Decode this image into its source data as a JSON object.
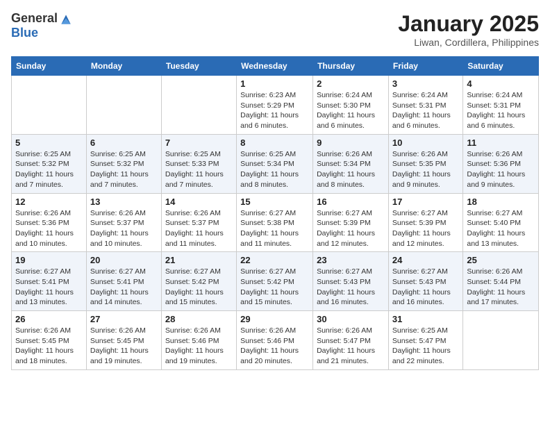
{
  "logo": {
    "general": "General",
    "blue": "Blue"
  },
  "header": {
    "month": "January 2025",
    "location": "Liwan, Cordillera, Philippines"
  },
  "days_of_week": [
    "Sunday",
    "Monday",
    "Tuesday",
    "Wednesday",
    "Thursday",
    "Friday",
    "Saturday"
  ],
  "weeks": [
    [
      {
        "day": "",
        "info": ""
      },
      {
        "day": "",
        "info": ""
      },
      {
        "day": "",
        "info": ""
      },
      {
        "day": "1",
        "info": "Sunrise: 6:23 AM\nSunset: 5:29 PM\nDaylight: 11 hours and 6 minutes."
      },
      {
        "day": "2",
        "info": "Sunrise: 6:24 AM\nSunset: 5:30 PM\nDaylight: 11 hours and 6 minutes."
      },
      {
        "day": "3",
        "info": "Sunrise: 6:24 AM\nSunset: 5:31 PM\nDaylight: 11 hours and 6 minutes."
      },
      {
        "day": "4",
        "info": "Sunrise: 6:24 AM\nSunset: 5:31 PM\nDaylight: 11 hours and 6 minutes."
      }
    ],
    [
      {
        "day": "5",
        "info": "Sunrise: 6:25 AM\nSunset: 5:32 PM\nDaylight: 11 hours and 7 minutes."
      },
      {
        "day": "6",
        "info": "Sunrise: 6:25 AM\nSunset: 5:32 PM\nDaylight: 11 hours and 7 minutes."
      },
      {
        "day": "7",
        "info": "Sunrise: 6:25 AM\nSunset: 5:33 PM\nDaylight: 11 hours and 7 minutes."
      },
      {
        "day": "8",
        "info": "Sunrise: 6:25 AM\nSunset: 5:34 PM\nDaylight: 11 hours and 8 minutes."
      },
      {
        "day": "9",
        "info": "Sunrise: 6:26 AM\nSunset: 5:34 PM\nDaylight: 11 hours and 8 minutes."
      },
      {
        "day": "10",
        "info": "Sunrise: 6:26 AM\nSunset: 5:35 PM\nDaylight: 11 hours and 9 minutes."
      },
      {
        "day": "11",
        "info": "Sunrise: 6:26 AM\nSunset: 5:36 PM\nDaylight: 11 hours and 9 minutes."
      }
    ],
    [
      {
        "day": "12",
        "info": "Sunrise: 6:26 AM\nSunset: 5:36 PM\nDaylight: 11 hours and 10 minutes."
      },
      {
        "day": "13",
        "info": "Sunrise: 6:26 AM\nSunset: 5:37 PM\nDaylight: 11 hours and 10 minutes."
      },
      {
        "day": "14",
        "info": "Sunrise: 6:26 AM\nSunset: 5:37 PM\nDaylight: 11 hours and 11 minutes."
      },
      {
        "day": "15",
        "info": "Sunrise: 6:27 AM\nSunset: 5:38 PM\nDaylight: 11 hours and 11 minutes."
      },
      {
        "day": "16",
        "info": "Sunrise: 6:27 AM\nSunset: 5:39 PM\nDaylight: 11 hours and 12 minutes."
      },
      {
        "day": "17",
        "info": "Sunrise: 6:27 AM\nSunset: 5:39 PM\nDaylight: 11 hours and 12 minutes."
      },
      {
        "day": "18",
        "info": "Sunrise: 6:27 AM\nSunset: 5:40 PM\nDaylight: 11 hours and 13 minutes."
      }
    ],
    [
      {
        "day": "19",
        "info": "Sunrise: 6:27 AM\nSunset: 5:41 PM\nDaylight: 11 hours and 13 minutes."
      },
      {
        "day": "20",
        "info": "Sunrise: 6:27 AM\nSunset: 5:41 PM\nDaylight: 11 hours and 14 minutes."
      },
      {
        "day": "21",
        "info": "Sunrise: 6:27 AM\nSunset: 5:42 PM\nDaylight: 11 hours and 15 minutes."
      },
      {
        "day": "22",
        "info": "Sunrise: 6:27 AM\nSunset: 5:42 PM\nDaylight: 11 hours and 15 minutes."
      },
      {
        "day": "23",
        "info": "Sunrise: 6:27 AM\nSunset: 5:43 PM\nDaylight: 11 hours and 16 minutes."
      },
      {
        "day": "24",
        "info": "Sunrise: 6:27 AM\nSunset: 5:43 PM\nDaylight: 11 hours and 16 minutes."
      },
      {
        "day": "25",
        "info": "Sunrise: 6:26 AM\nSunset: 5:44 PM\nDaylight: 11 hours and 17 minutes."
      }
    ],
    [
      {
        "day": "26",
        "info": "Sunrise: 6:26 AM\nSunset: 5:45 PM\nDaylight: 11 hours and 18 minutes."
      },
      {
        "day": "27",
        "info": "Sunrise: 6:26 AM\nSunset: 5:45 PM\nDaylight: 11 hours and 19 minutes."
      },
      {
        "day": "28",
        "info": "Sunrise: 6:26 AM\nSunset: 5:46 PM\nDaylight: 11 hours and 19 minutes."
      },
      {
        "day": "29",
        "info": "Sunrise: 6:26 AM\nSunset: 5:46 PM\nDaylight: 11 hours and 20 minutes."
      },
      {
        "day": "30",
        "info": "Sunrise: 6:26 AM\nSunset: 5:47 PM\nDaylight: 11 hours and 21 minutes."
      },
      {
        "day": "31",
        "info": "Sunrise: 6:25 AM\nSunset: 5:47 PM\nDaylight: 11 hours and 22 minutes."
      },
      {
        "day": "",
        "info": ""
      }
    ]
  ]
}
